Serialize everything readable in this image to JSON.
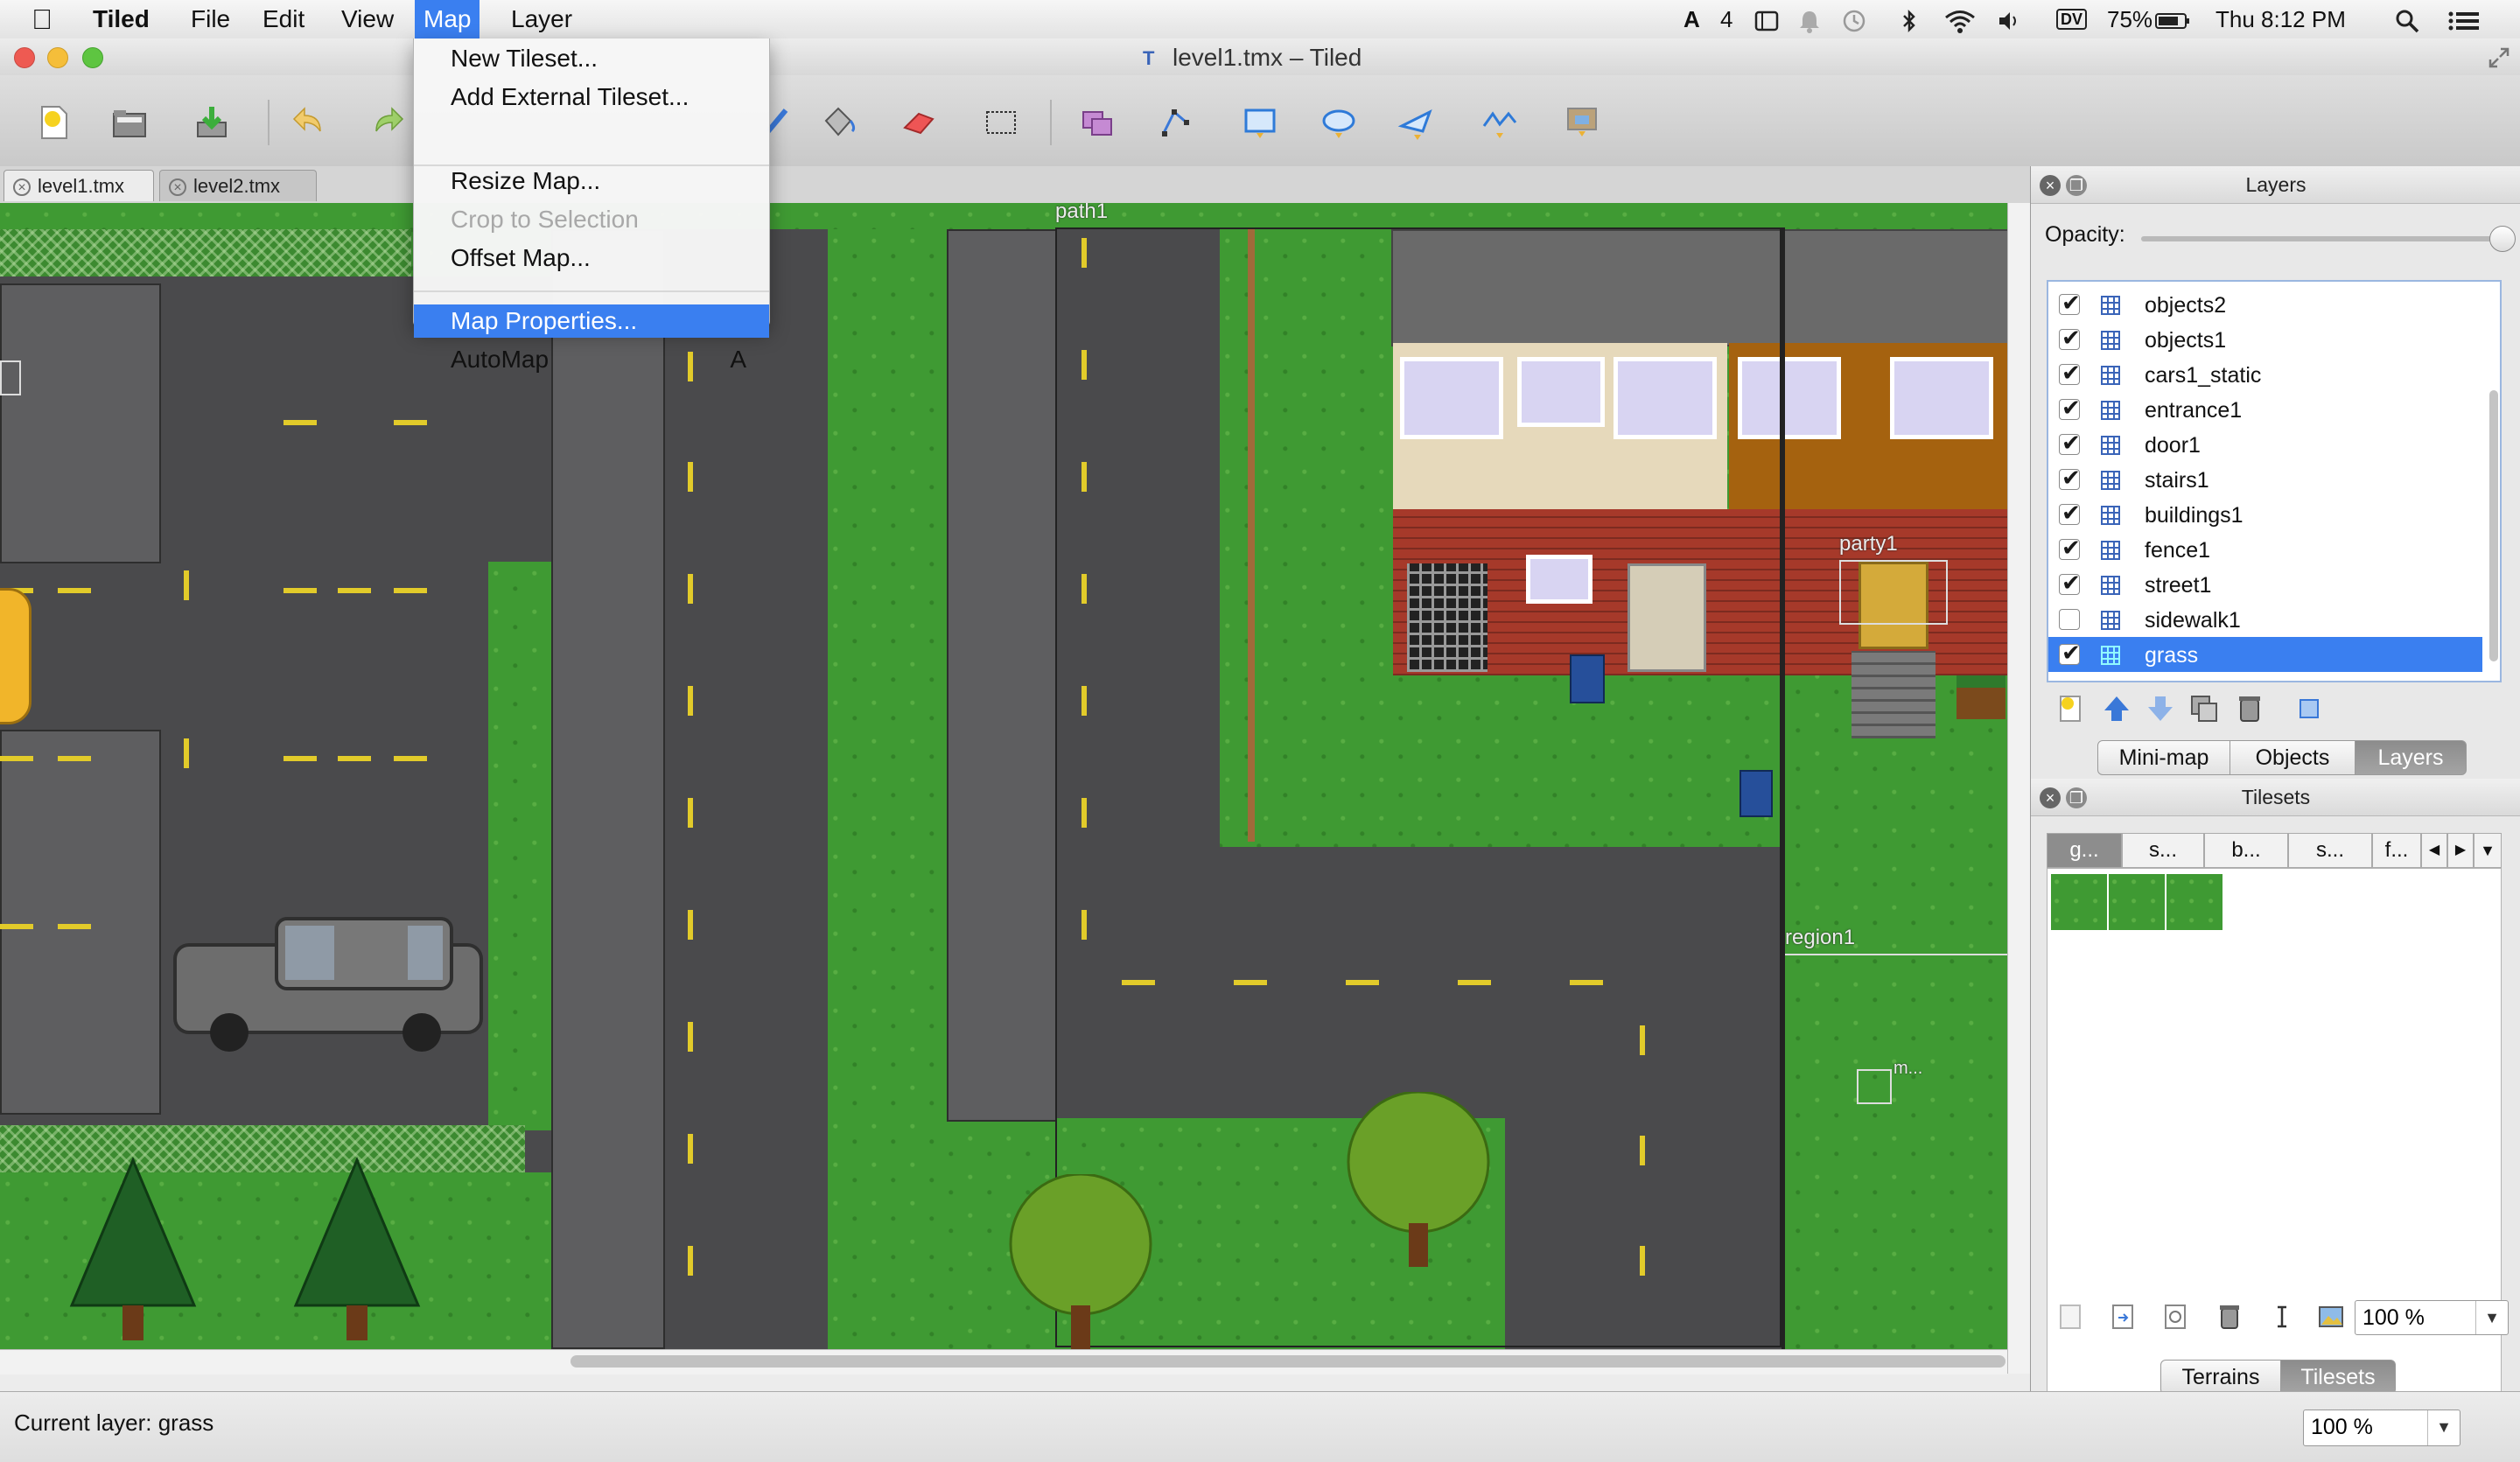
{
  "menubar": {
    "app_name": "Tiled",
    "items": [
      "File",
      "Edit",
      "View",
      "Map",
      "Layer"
    ],
    "active_menu": "Map",
    "status": {
      "notif_count": "4",
      "battery": "75%",
      "clock": "Thu 8:12 PM",
      "input_source": "DV"
    }
  },
  "window": {
    "title": "level1.tmx – Tiled"
  },
  "toolbar": {
    "buttons": [
      "new-file-icon",
      "open-file-icon",
      "save-icon",
      "undo-icon",
      "redo-icon",
      "stamp-brush-icon",
      "bucket-fill-icon",
      "eraser-icon",
      "rect-select-icon",
      "magic-wand-icon",
      "edit-polygons-icon",
      "insert-rectangle-icon",
      "insert-ellipse-icon",
      "insert-polygon-icon",
      "insert-polyline-icon",
      "insert-tile-icon"
    ]
  },
  "tabs": [
    {
      "label": "level1.tmx",
      "active": true
    },
    {
      "label": "level2.tmx",
      "active": false
    }
  ],
  "map_menu": {
    "items": [
      {
        "label": "New Tileset...",
        "shortcut": "",
        "disabled": false,
        "highlighted": false
      },
      {
        "label": "Add External Tileset...",
        "shortcut": "",
        "disabled": false,
        "highlighted": false
      },
      {
        "label": "Resize Map...",
        "shortcut": "",
        "disabled": false,
        "highlighted": false
      },
      {
        "label": "Crop to Selection",
        "shortcut": "",
        "disabled": true,
        "highlighted": false
      },
      {
        "label": "Offset Map...",
        "shortcut": "",
        "disabled": false,
        "highlighted": false
      },
      {
        "label": "Map Properties...",
        "shortcut": "",
        "disabled": false,
        "highlighted": true
      },
      {
        "label": "AutoMap",
        "shortcut": "A",
        "disabled": false,
        "highlighted": false
      }
    ]
  },
  "map_objects": {
    "path_label": "path1",
    "party_label": "party1",
    "region_label": "region1",
    "small_obj_label": "m..."
  },
  "layers_panel": {
    "title": "Layers",
    "opacity_label": "Opacity:",
    "opacity_value": 1.0,
    "layers": [
      {
        "name": "objects2",
        "visible": true,
        "selected": false
      },
      {
        "name": "objects1",
        "visible": true,
        "selected": false
      },
      {
        "name": "cars1_static",
        "visible": true,
        "selected": false
      },
      {
        "name": "entrance1",
        "visible": true,
        "selected": false
      },
      {
        "name": "door1",
        "visible": true,
        "selected": false
      },
      {
        "name": "stairs1",
        "visible": true,
        "selected": false
      },
      {
        "name": "buildings1",
        "visible": true,
        "selected": false
      },
      {
        "name": "fence1",
        "visible": true,
        "selected": false
      },
      {
        "name": "street1",
        "visible": true,
        "selected": false
      },
      {
        "name": "sidewalk1",
        "visible": false,
        "selected": false
      },
      {
        "name": "grass",
        "visible": true,
        "selected": true
      }
    ],
    "view_tabs": [
      {
        "label": "Mini-map",
        "active": false
      },
      {
        "label": "Objects",
        "active": false
      },
      {
        "label": "Layers",
        "active": true
      }
    ]
  },
  "tilesets_panel": {
    "title": "Tilesets",
    "tabs": [
      "g...",
      "s...",
      "b...",
      "s...",
      "f..."
    ],
    "active_tab": 0,
    "zoom": "100 %",
    "bottom_tabs": [
      {
        "label": "Terrains",
        "active": false
      },
      {
        "label": "Tilesets",
        "active": true
      }
    ]
  },
  "statusbar": {
    "current_layer": "Current layer: grass",
    "zoom": "100 %"
  },
  "colors": {
    "accent": "#3a7ff0",
    "grass": "#3f9a33",
    "asphalt": "#4a4a4c",
    "lane_marking": "#e2cb2a"
  }
}
